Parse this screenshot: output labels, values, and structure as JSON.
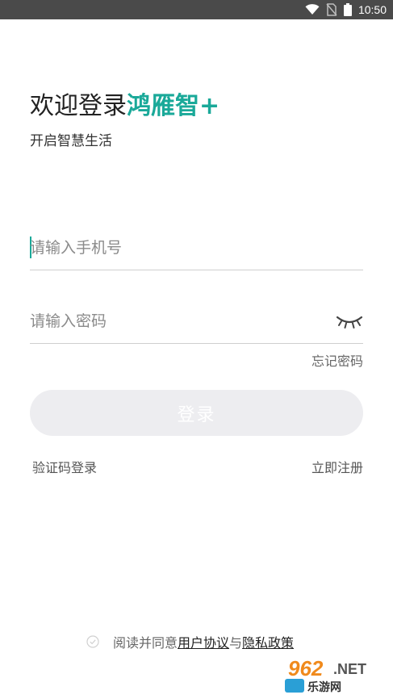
{
  "status_bar": {
    "time": "10:50",
    "icons": [
      "wifi-icon",
      "no-sim-icon",
      "battery-icon"
    ]
  },
  "header": {
    "welcome_prefix": "欢迎登录",
    "brand": "鸿雁智+",
    "subtitle": "开启智慧生活"
  },
  "form": {
    "phone_placeholder": "请输入手机号",
    "phone_value": "",
    "password_placeholder": "请输入密码",
    "password_value": "",
    "forgot_label": "忘记密码",
    "login_label": "登录"
  },
  "links": {
    "sms_login": "验证码登录",
    "register": "立即注册"
  },
  "agreement": {
    "prefix": "阅读并同意",
    "user_agreement": "用户协议",
    "conjunction": "与",
    "privacy_policy": "隐私政策",
    "checked": false
  },
  "watermark": {
    "brand_text": "962.NET",
    "brand_subtext": "乐游网"
  },
  "colors": {
    "accent": "#1aa999",
    "status_bar": "#4a4a4a",
    "button_disabled": "#ededf0",
    "divider": "#cfcfcf"
  }
}
